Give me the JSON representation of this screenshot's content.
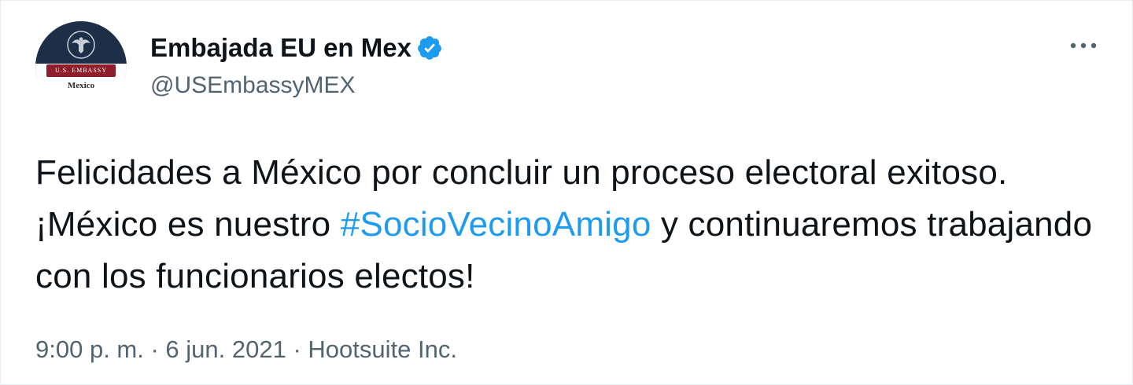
{
  "account": {
    "display_name": "Embajada EU en Mex",
    "handle": "@USEmbassyMEX",
    "verified": true,
    "avatar": {
      "banner_text": "U.S. EMBASSY",
      "city_text": "Mexico"
    }
  },
  "tweet": {
    "text_before": "Felicidades a México por concluir un proceso electoral exitoso. ¡México es nuestro ",
    "hashtag": "#SocioVecinoAmigo",
    "text_after": " y continuaremos trabajando con los funcionarios electos!"
  },
  "meta": {
    "time": "9:00 p. m.",
    "separator": " · ",
    "date": "6 jun. 2021",
    "source": "Hootsuite Inc."
  },
  "colors": {
    "accent": "#1d9bf0",
    "text_primary": "#0f1419",
    "text_secondary": "#536471",
    "avatar_navy": "#1d2f47",
    "avatar_red": "#8e1f2a"
  },
  "icons": {
    "verified": "verified-badge-icon",
    "more": "more-dots-icon"
  }
}
